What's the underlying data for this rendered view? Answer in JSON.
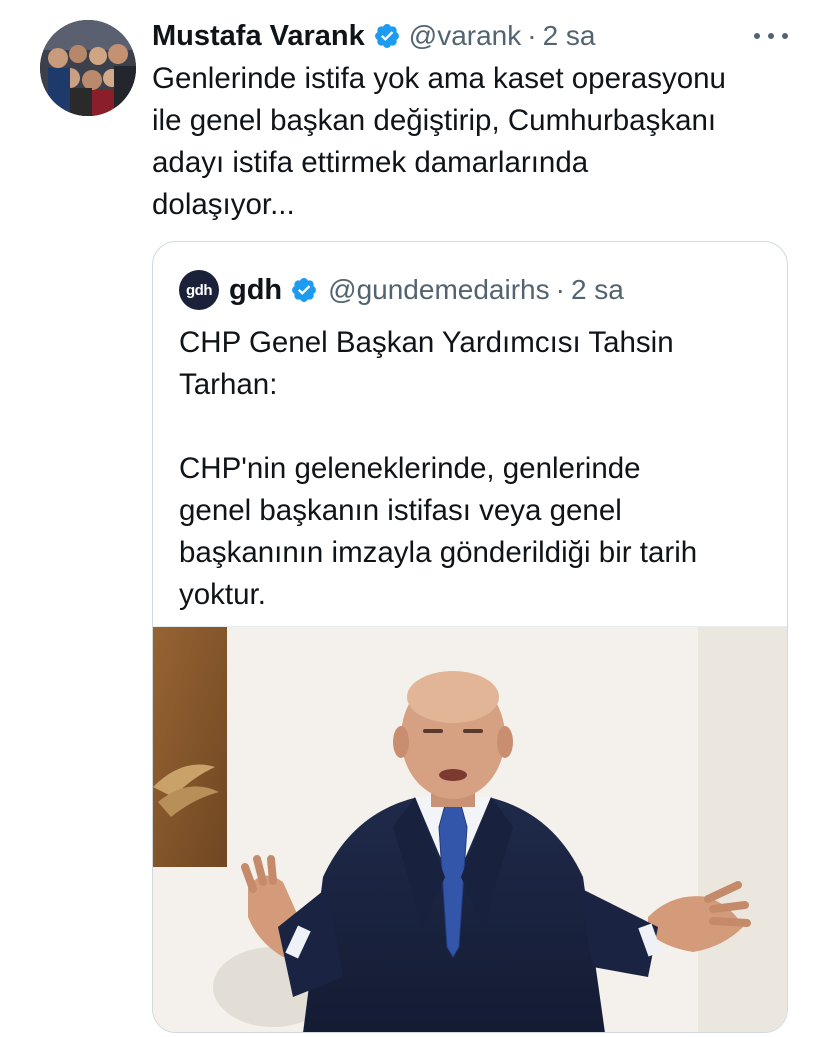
{
  "tweet": {
    "author_name": "Mustafa Varank",
    "handle": "@varank",
    "separator": "·",
    "time": "2 sa",
    "text": "Genlerinde istifa yok ama kaset operasyonu\nile genel başkan değiştirip, Cumhurbaşkanı\nadayı istifa ettirmek damarlarında\ndolaşıyor...",
    "more_icon": "more-horizontal-icon",
    "verified_icon": "verified-badge-icon"
  },
  "quote": {
    "logo_text": "gdh",
    "author_name": "gdh",
    "handle": "@gundemedairhs",
    "separator": "·",
    "time": "2 sa",
    "text": "CHP Genel Başkan Yardımcısı Tahsin\nTarhan:\n\nCHP'nin geleneklerinde, genlerinde\ngenel başkanın istifası veya genel\nbaşkanının imzayla gönderildiği bir tarih\nyoktur."
  },
  "colors": {
    "text": "#0f1419",
    "secondary": "#536471",
    "verified": "#1d9bf0",
    "border": "#cfd9de",
    "logo_bg": "#1a2138"
  }
}
